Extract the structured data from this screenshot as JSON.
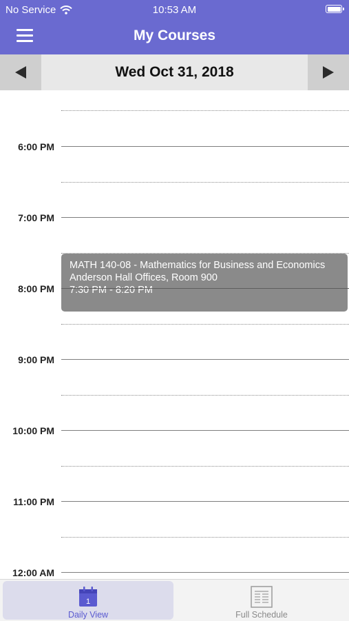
{
  "status_bar": {
    "carrier": "No Service",
    "time": "10:53 AM"
  },
  "header": {
    "title": "My Courses"
  },
  "date_nav": {
    "date": "Wed Oct 31, 2018"
  },
  "schedule": {
    "hours": [
      "6:00 PM",
      "7:00 PM",
      "8:00 PM",
      "9:00 PM",
      "10:00 PM",
      "11:00 PM",
      "12:00 AM"
    ],
    "event": {
      "course": "MATH 140-08 - Mathematics for Business and Economics",
      "location": "Anderson Hall Offices, Room 900",
      "time": "7:30 PM - 8:20 PM"
    }
  },
  "tabs": {
    "daily": "Daily View",
    "daily_icon_number": "1",
    "full": "Full Schedule"
  },
  "colors": {
    "header": "#6a6ad0",
    "event": "#8a8a8a",
    "active_tab": "#5a5ad0"
  }
}
